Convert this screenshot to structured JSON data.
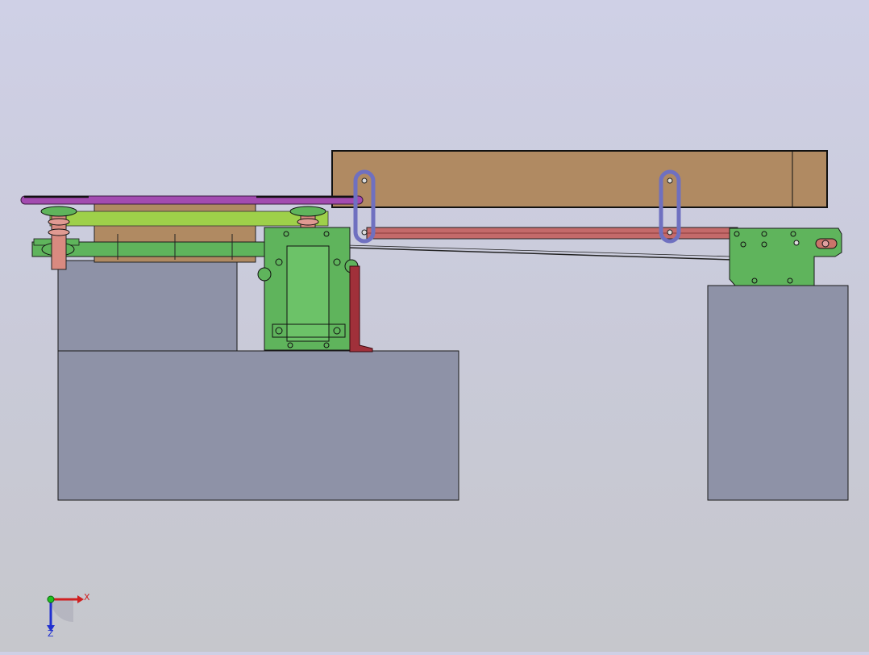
{
  "viewport": {
    "background_top": "#cfd0e6",
    "background_bottom": "#c6c7cc"
  },
  "colors": {
    "base_block": "#8e92a7",
    "wood_beam": "#b08a62",
    "green_plate": "#5fb45c",
    "light_green": "#9ed04a",
    "purple_rail": "#a34bb0",
    "salmon_post": "#d98a80",
    "red_rail": "#c46a6a",
    "blue_link": "#6f70c0",
    "dark_red": "#a0303a",
    "outline": "#1a1a1a"
  },
  "triad": {
    "x_label": "X",
    "z_label": "Z",
    "x_color": "#d02020",
    "y_color": "#20c020",
    "z_color": "#2030d0"
  }
}
